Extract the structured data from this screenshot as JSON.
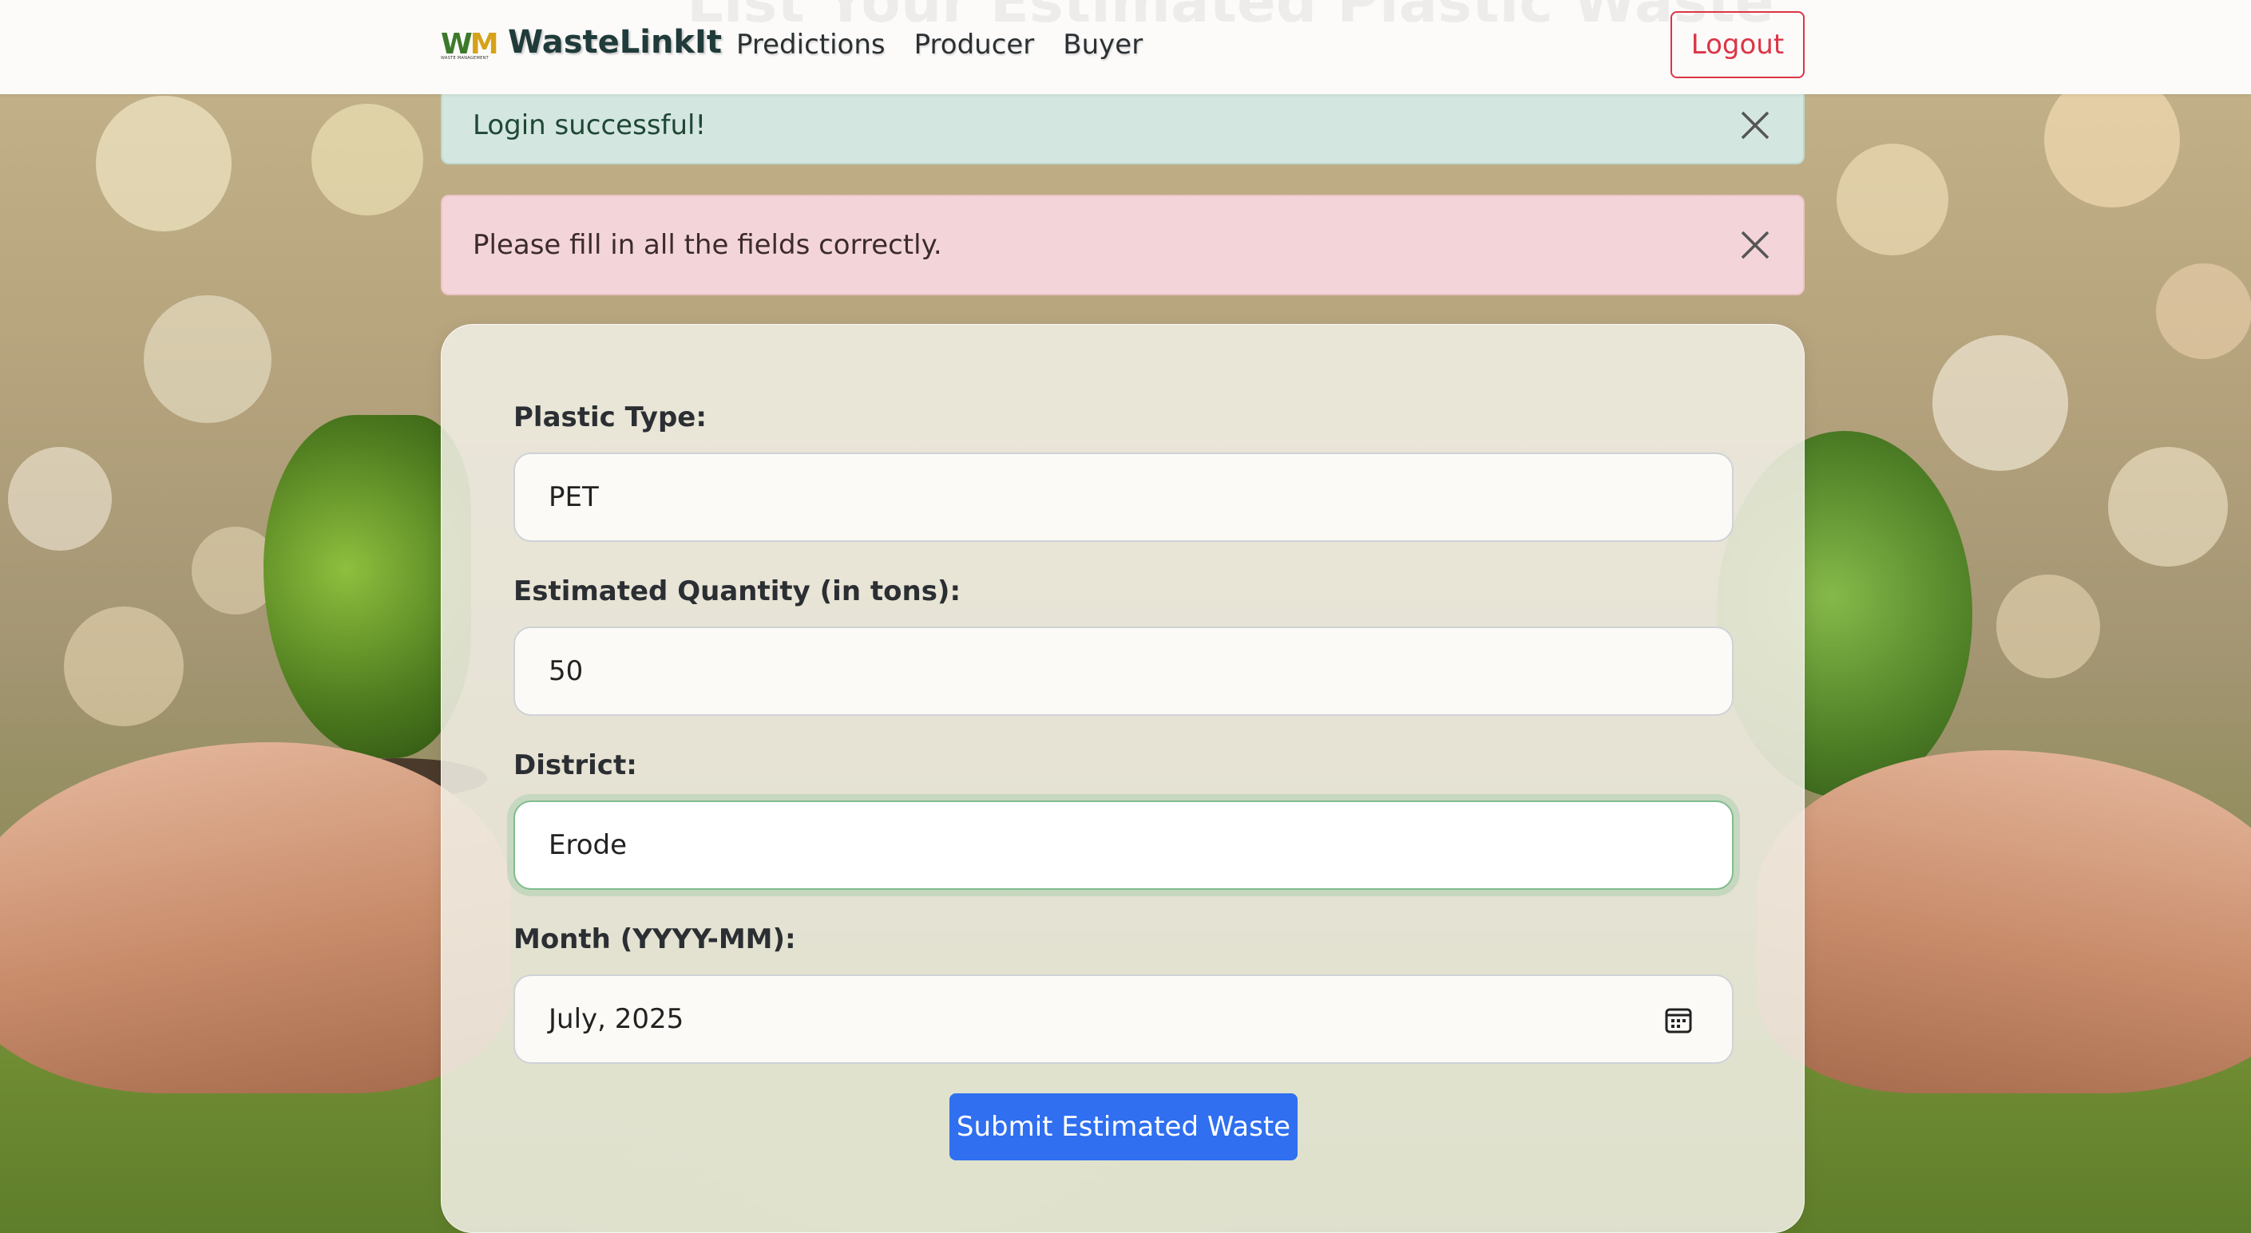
{
  "navbar": {
    "hidden_heading": "List Your Estimated Plastic Waste",
    "logo_text_w": "W",
    "logo_text_m": "M",
    "logo_subtext": "WASTE MANAGEMENT",
    "brand": "WasteLinkIt",
    "links": [
      "Predictions",
      "Producer",
      "Buyer"
    ],
    "logout_label": "Logout"
  },
  "alerts": {
    "success": "Login successful!",
    "error": "Please fill in all the fields correctly."
  },
  "form": {
    "plastic_type": {
      "label": "Plastic Type:",
      "value": "PET"
    },
    "quantity": {
      "label": "Estimated Quantity (in tons):",
      "value": "50"
    },
    "district": {
      "label": "District:",
      "value": "Erode"
    },
    "month": {
      "label": "Month (YYYY-MM):",
      "value": "July, 2025"
    },
    "submit_label": "Submit Estimated Waste"
  },
  "colors": {
    "primary": "#2f6ff0",
    "danger": "#dc3545",
    "success_alert_bg": "#d4e6e0",
    "error_alert_bg": "#f3d5d9",
    "focus_ring": "#7fbd8e",
    "brand_text": "#1f3b3a"
  },
  "icons": {
    "close": "close-icon",
    "calendar": "calendar-icon"
  }
}
